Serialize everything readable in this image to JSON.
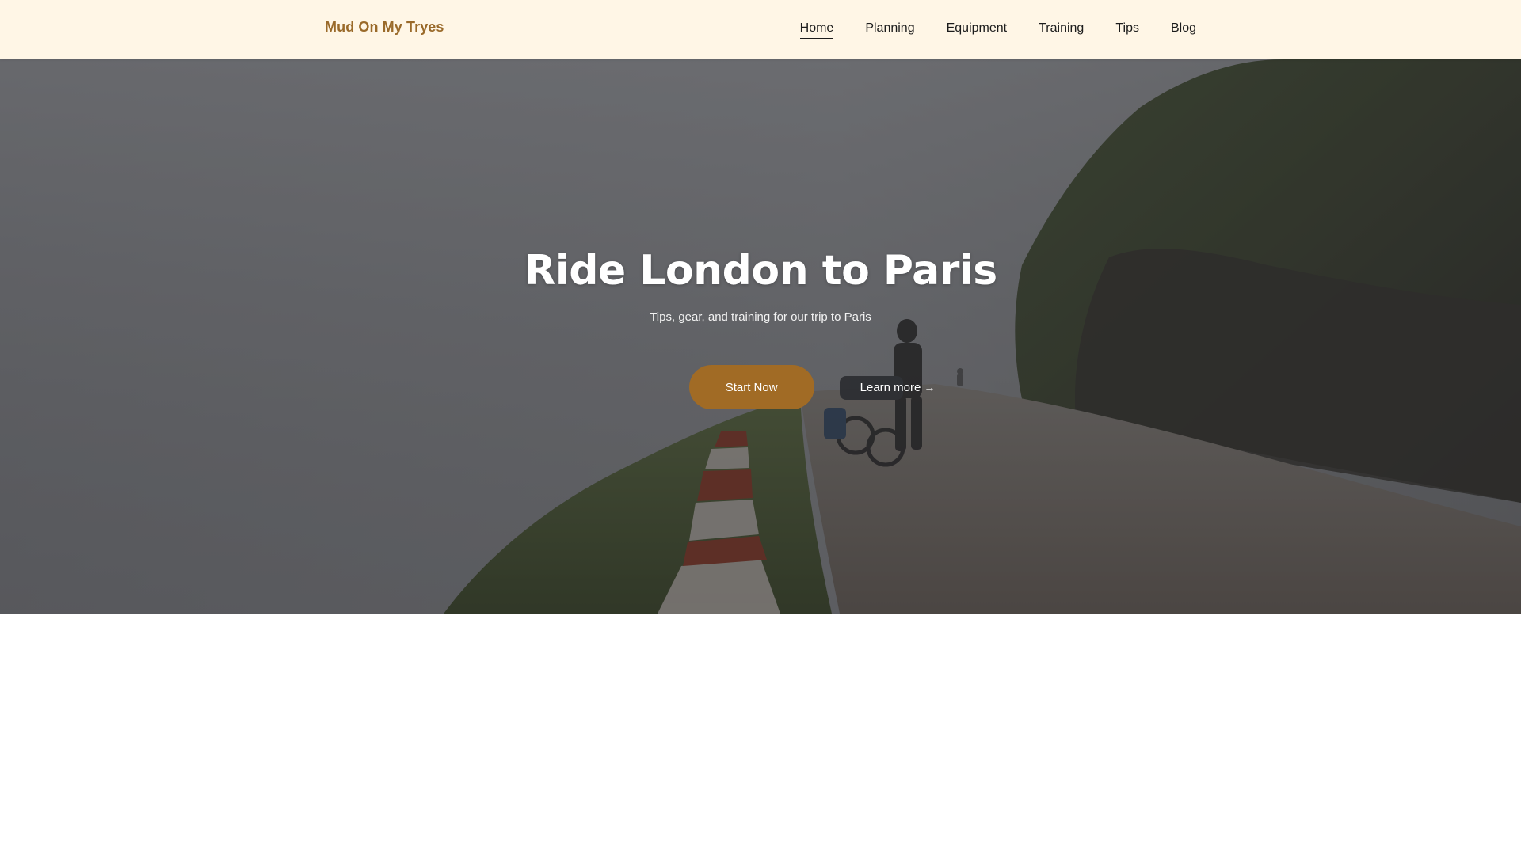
{
  "site": {
    "brand": "Mud On My Tryes"
  },
  "nav": {
    "items": [
      {
        "label": "Home",
        "active": true
      },
      {
        "label": "Planning",
        "active": false
      },
      {
        "label": "Equipment",
        "active": false
      },
      {
        "label": "Training",
        "active": false
      },
      {
        "label": "Tips",
        "active": false
      },
      {
        "label": "Blog",
        "active": false
      }
    ]
  },
  "hero": {
    "title": "Ride London to Paris",
    "subtitle": "Tips, gear, and training for our trip to Paris",
    "primary_button": "Start Now",
    "secondary_link": "Learn more",
    "secondary_link_icon": "arrow-right-icon",
    "secondary_link_glyph": "→",
    "image_description_name": "cyclist-mountain-road-photo"
  },
  "colors": {
    "header_bg": "#fff6e6",
    "brand": "#9a6a2a",
    "accent_button": "#a16b25",
    "hero_text": "#ffffff"
  }
}
